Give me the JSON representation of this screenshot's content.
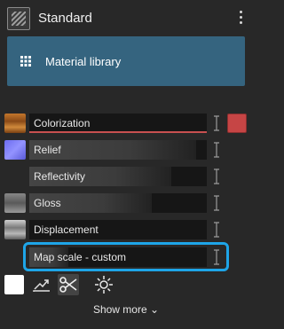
{
  "header": {
    "title": "Standard",
    "thumb_icon": "hatched-material-icon",
    "menu_icon": "kebab-menu-icon"
  },
  "library": {
    "label": "Material library",
    "icon": "grid-icon"
  },
  "properties": [
    {
      "name": "colorization",
      "label": "Colorization",
      "fill": 0.0,
      "swatch": "wood",
      "color_chip": "#c64545"
    },
    {
      "name": "relief",
      "label": "Relief",
      "fill": 0.94,
      "swatch": "blue"
    },
    {
      "name": "reflectivity",
      "label": "Reflectivity",
      "fill": 0.8,
      "swatch": "none"
    },
    {
      "name": "gloss",
      "label": "Gloss",
      "fill": 0.69,
      "swatch": "grey-stone"
    },
    {
      "name": "displacement",
      "label": "Displacement",
      "fill": 0.0,
      "swatch": "grey-rough"
    },
    {
      "name": "map-scale",
      "label": "Map scale - custom",
      "fill": 0.22,
      "swatch": "none"
    }
  ],
  "tools": [
    "white-color-swatch",
    "chart-arrow-icon",
    "scissors-icon",
    "sun-icon"
  ],
  "footer": {
    "show_more": "Show more ⌄"
  }
}
